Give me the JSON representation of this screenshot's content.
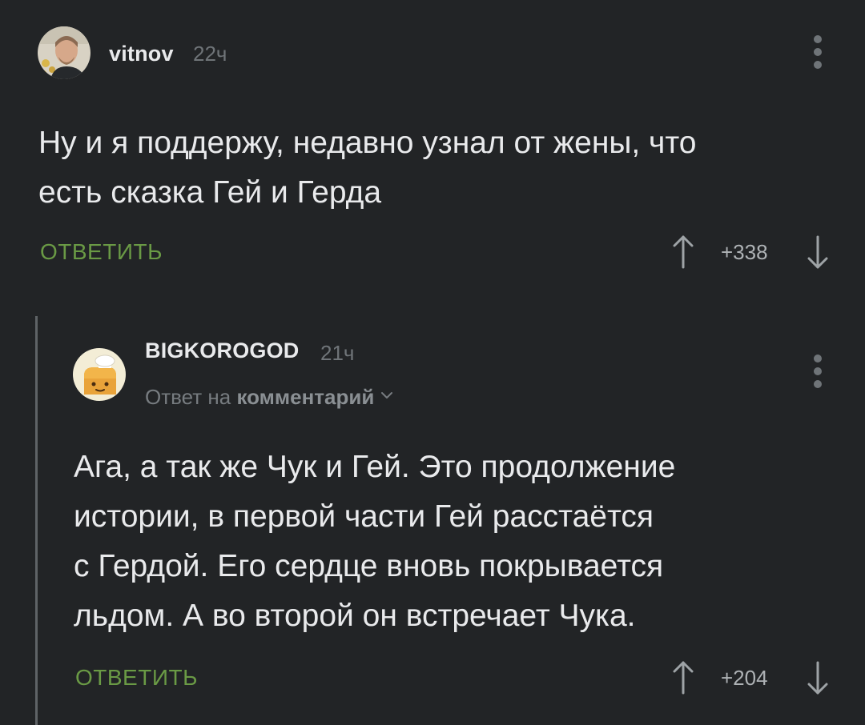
{
  "comments": [
    {
      "author": "vitnov",
      "time": "22ч",
      "text": "Ну и я поддержу, недавно узнал от жены, что\nесть сказка Гей и Герда",
      "reply_label": "ОТВЕТИТЬ",
      "score": "+338",
      "avatar_icon": "user-photo-avatar"
    },
    {
      "author": "BIGKOROGOD",
      "time": "21ч",
      "reply_to_prefix": "Ответ на",
      "reply_to_link": "комментарий",
      "text": "Ага, а так же Чук и Гей. Это продолжение\nистории, в первой части Гей расстаётся\nс Гердой. Его сердце вновь покрывается\nльдом. А во второй он встречает Чука.",
      "reply_label": "ОТВЕТИТЬ",
      "score": "+204",
      "avatar_icon": "cartoon-avatar"
    }
  ],
  "colors": {
    "background": "#222426",
    "text": "#e9eaec",
    "muted": "#6f7478",
    "reply": "#6a9a45",
    "thread_line": "#5f6366"
  }
}
